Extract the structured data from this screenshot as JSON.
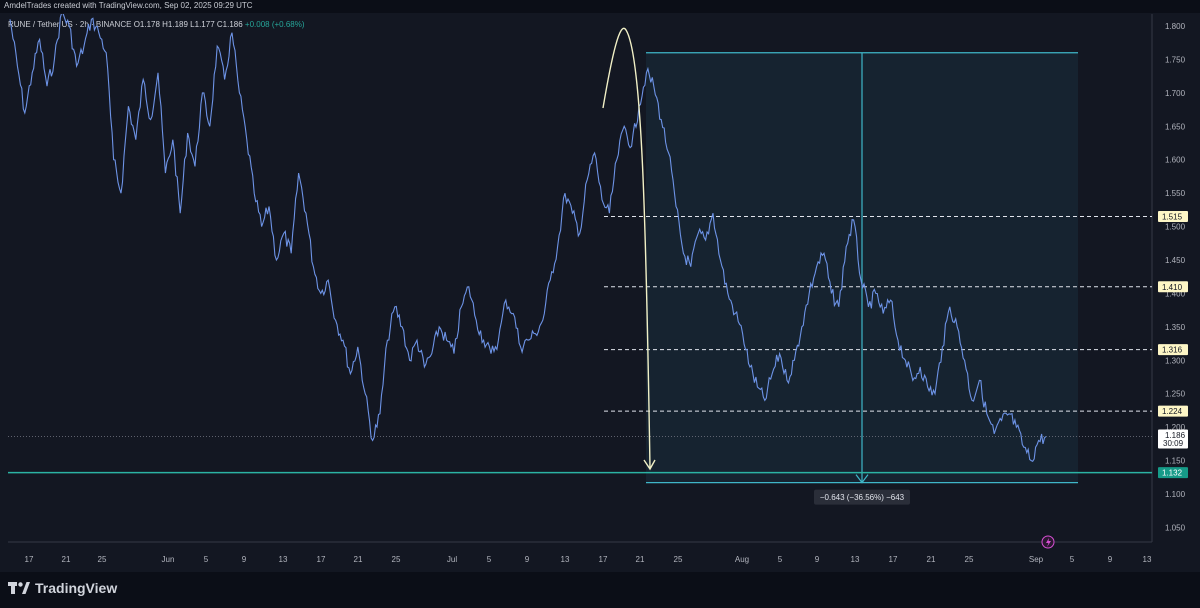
{
  "header": {
    "credit": "AmdelTrades created with TradingView.com, Sep 02, 2025 09:29 UTC"
  },
  "legend": {
    "pair": "RUNE / Tether US · 2h · BINANCE",
    "ohlc": "O1.178 H1.189 L1.177 C1.186",
    "change": "+0.008 (+0.68%)"
  },
  "footer": {
    "logo_text": "TradingView"
  },
  "colors": {
    "background": "#131722",
    "price_line": "#6d93e6",
    "cyan": "#3fb6c8",
    "arrow": "#f1f0c6",
    "level_tag_bg": "#fdf6c6",
    "support_tag_bg": "#169b88"
  },
  "chart_data": {
    "type": "line",
    "title": "",
    "ylim": [
      1.03,
      1.81
    ],
    "y_ticks": [
      "1.800",
      "1.750",
      "1.700",
      "1.650",
      "1.600",
      "1.550",
      "1.500",
      "1.450",
      "1.400",
      "1.350",
      "1.300",
      "1.250",
      "1.200",
      "1.150",
      "1.100",
      "1.050"
    ],
    "x_ticks": [
      "17",
      "21",
      "25",
      "Jun",
      "5",
      "9",
      "13",
      "17",
      "21",
      "25",
      "Jul",
      "5",
      "9",
      "13",
      "17",
      "21",
      "25",
      "Aug",
      "5",
      "9",
      "13",
      "17",
      "21",
      "25",
      "Sep",
      "5",
      "9",
      "13"
    ],
    "series": [
      {
        "values": [
          1.81,
          1.74,
          1.67,
          1.73,
          1.78,
          1.71,
          1.75,
          1.82,
          1.8,
          1.74,
          1.77,
          1.81,
          1.79,
          1.76,
          1.6,
          1.55,
          1.68,
          1.63,
          1.72,
          1.66,
          1.73,
          1.58,
          1.63,
          1.52,
          1.64,
          1.59,
          1.7,
          1.65,
          1.77,
          1.72,
          1.79,
          1.7,
          1.63,
          1.55,
          1.5,
          1.53,
          1.45,
          1.49,
          1.46,
          1.58,
          1.52,
          1.44,
          1.4,
          1.42,
          1.36,
          1.33,
          1.28,
          1.32,
          1.25,
          1.18,
          1.22,
          1.33,
          1.38,
          1.35,
          1.3,
          1.33,
          1.29,
          1.31,
          1.35,
          1.33,
          1.31,
          1.38,
          1.41,
          1.36,
          1.33,
          1.31,
          1.33,
          1.39,
          1.37,
          1.32,
          1.33,
          1.34,
          1.36,
          1.42,
          1.47,
          1.55,
          1.52,
          1.49,
          1.57,
          1.61,
          1.54,
          1.52,
          1.6,
          1.65,
          1.62,
          1.68,
          1.73,
          1.71,
          1.66,
          1.61,
          1.53,
          1.46,
          1.44,
          1.49,
          1.48,
          1.52,
          1.45,
          1.4,
          1.37,
          1.34,
          1.29,
          1.26,
          1.24,
          1.28,
          1.31,
          1.27,
          1.3,
          1.35,
          1.4,
          1.44,
          1.46,
          1.4,
          1.38,
          1.47,
          1.51,
          1.42,
          1.38,
          1.4,
          1.37,
          1.39,
          1.33,
          1.3,
          1.27,
          1.29,
          1.26,
          1.25,
          1.32,
          1.38,
          1.35,
          1.3,
          1.24,
          1.27,
          1.22,
          1.19,
          1.21,
          1.22,
          1.2,
          1.17,
          1.15,
          1.18,
          1.186
        ]
      }
    ],
    "levels": [
      {
        "value": 1.515,
        "label": "1.515"
      },
      {
        "value": 1.41,
        "label": "1.410"
      },
      {
        "value": 1.316,
        "label": "1.316"
      },
      {
        "value": 1.224,
        "label": "1.224"
      }
    ],
    "support": {
      "value": 1.132,
      "label": "1.132"
    },
    "current": {
      "value": 1.186,
      "label": "1.186",
      "countdown": "30:09"
    },
    "measure": {
      "from": 1.76,
      "to": 1.117,
      "label": "−0.643 (−36.56%) −643"
    }
  }
}
